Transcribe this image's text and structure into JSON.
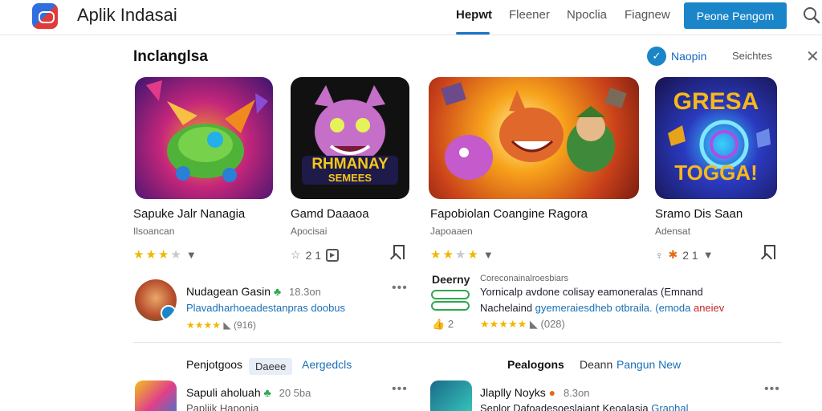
{
  "header": {
    "app_title": "Aplik Indasai",
    "nav": [
      "Hepwt",
      "Fleener",
      "Npoclia",
      "Fiagnew"
    ],
    "primary_button": "Peone Pengom",
    "colors": {
      "accent": "#1a86c9",
      "nav_underline": "#1a73c8"
    }
  },
  "section": {
    "title": "Inclanglsa",
    "filter_label": "Naopin",
    "sort_label": "Seichtes"
  },
  "cards": [
    {
      "name": "Sapuke Jalr Nanagia",
      "developer": "Ilsoancan",
      "rating": 3,
      "art_text": ""
    },
    {
      "name": "Gamd Daaaoa",
      "developer": "Apocisai",
      "meta": "2 1",
      "art_text": "RHMANAY",
      "art_sub": "SEMEES"
    },
    {
      "name": "Fapobiolan Coangine Ragora",
      "developer": "Japoaaen",
      "rating": 4,
      "art_text": ""
    },
    {
      "name": "Sramo Dis Saan",
      "developer": "Adensat",
      "meta": "2 1",
      "art_text": "GRESA",
      "art_sub": "TOGGA!"
    }
  ],
  "reviews": [
    {
      "name": "Nudagean Gasin",
      "time": "18.3on",
      "text": "Plavadharhoeadestanpras doobus",
      "stars": "★★★★",
      "count": "(916)"
    },
    {
      "brand": "Deerny",
      "title": "Coreconainalroesbiars",
      "text_a": "Yornicalp avdone colisay eamoneralas (Emnand",
      "text_b_dark": "Nachelaind",
      "text_b": "gyemeraiesdheb otbraila. (emoda",
      "text_b_red": "aneiev",
      "reactions": "2",
      "stars": "★★★★★",
      "count": "(028)"
    }
  ],
  "tabs": {
    "left_title": "Penjotgoos",
    "left_pill": "Daeee",
    "left_link": "Aergedcls",
    "right_title": "Pealogons",
    "right_sub": "Deann",
    "right_link": "Pangun New"
  },
  "bottom": [
    {
      "name": "Sapuli aholuah",
      "time": "20 5ba",
      "sub": "Papliik Haponia"
    },
    {
      "name": "Jlaplly Noyks",
      "time": "8.3on",
      "sub": "Seplor Dafoadesoeslaiant Keoalasia",
      "link": "Graphal"
    }
  ]
}
